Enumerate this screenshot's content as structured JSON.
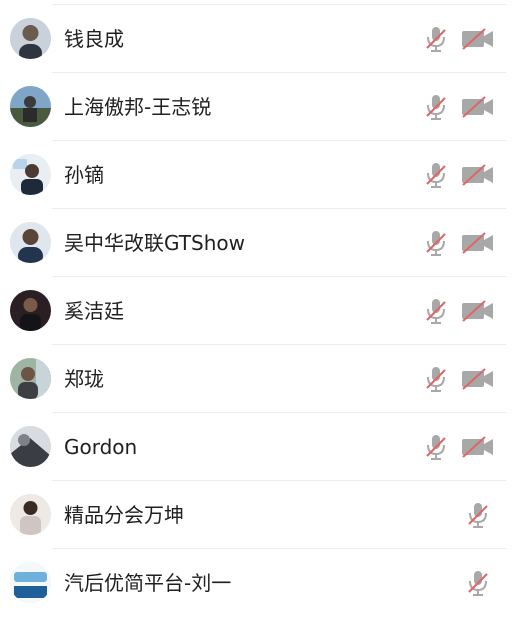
{
  "colors": {
    "icon_gray": "#a8a8a8",
    "slash_red": "#e06666",
    "divider": "#ececec",
    "text": "#1f1f1f"
  },
  "participants": [
    {
      "name": "钱良成",
      "mic": "muted",
      "camera": "off"
    },
    {
      "name": "上海傲邦-王志锐",
      "mic": "muted",
      "camera": "off"
    },
    {
      "name": "孙镝",
      "mic": "muted",
      "camera": "off"
    },
    {
      "name": "吴中华改联GTShow",
      "mic": "muted",
      "camera": "off"
    },
    {
      "name": "奚洁廷",
      "mic": "muted",
      "camera": "off"
    },
    {
      "name": "郑珑",
      "mic": "muted",
      "camera": "off"
    },
    {
      "name": "Gordon",
      "mic": "muted",
      "camera": "off"
    },
    {
      "name": "精品分会万坤",
      "mic": "muted"
    },
    {
      "name": "汽后优简平台-刘一",
      "mic": "muted"
    }
  ]
}
